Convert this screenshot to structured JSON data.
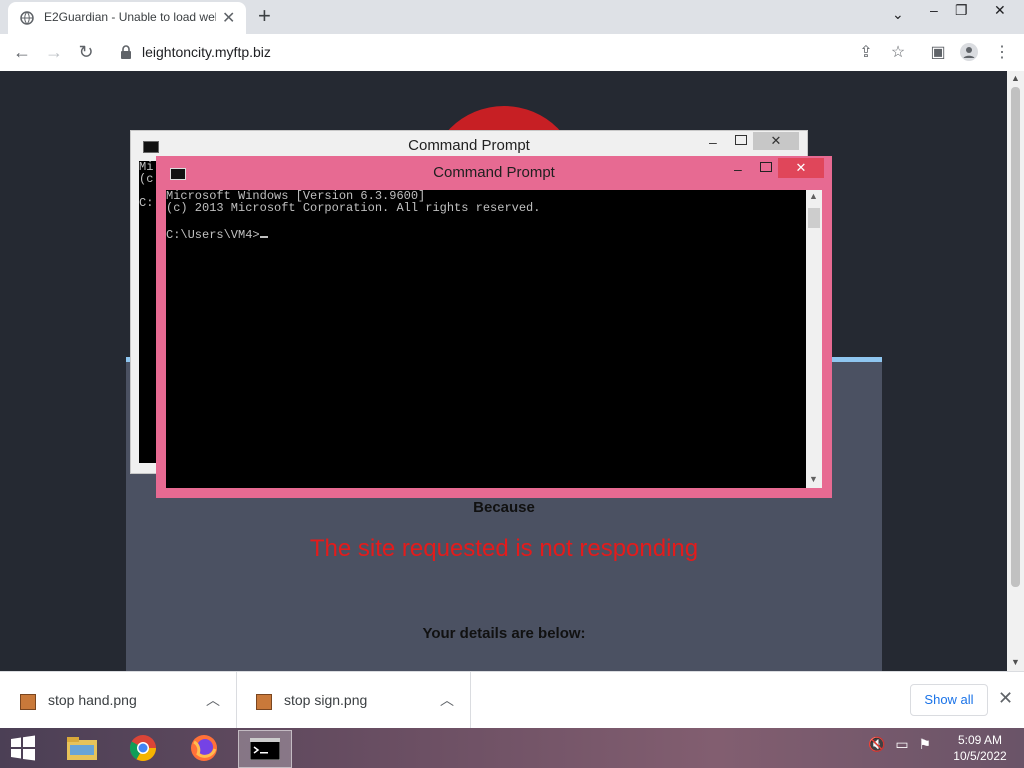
{
  "browser": {
    "tab_title": "E2Guardian - Unable to load web",
    "new_tab": "+",
    "url": "leightoncity.myftp.biz"
  },
  "page": {
    "because": "Because",
    "reason": "The site requested is not responding",
    "details_heading": "Your details are below:"
  },
  "cmd_back": {
    "title": "Command Prompt",
    "lines": [
      "Mi",
      "(c",
      "",
      "C:"
    ]
  },
  "cmd_front": {
    "title": "Command Prompt",
    "line1": "Microsoft Windows [Version 6.3.9600]",
    "line2": "(c) 2013 Microsoft Corporation. All rights reserved.",
    "prompt": "C:\\Users\\VM4>"
  },
  "downloads": {
    "items": [
      {
        "name": "stop hand.png"
      },
      {
        "name": "stop sign.png"
      }
    ],
    "show_all": "Show all"
  },
  "taskbar": {
    "time": "5:09 AM",
    "date": "10/5/2022"
  },
  "colors": {
    "reason_red": "#e41b1b",
    "cmd_front_frame": "#e76a92",
    "panel_accent": "#8fc6f0"
  }
}
